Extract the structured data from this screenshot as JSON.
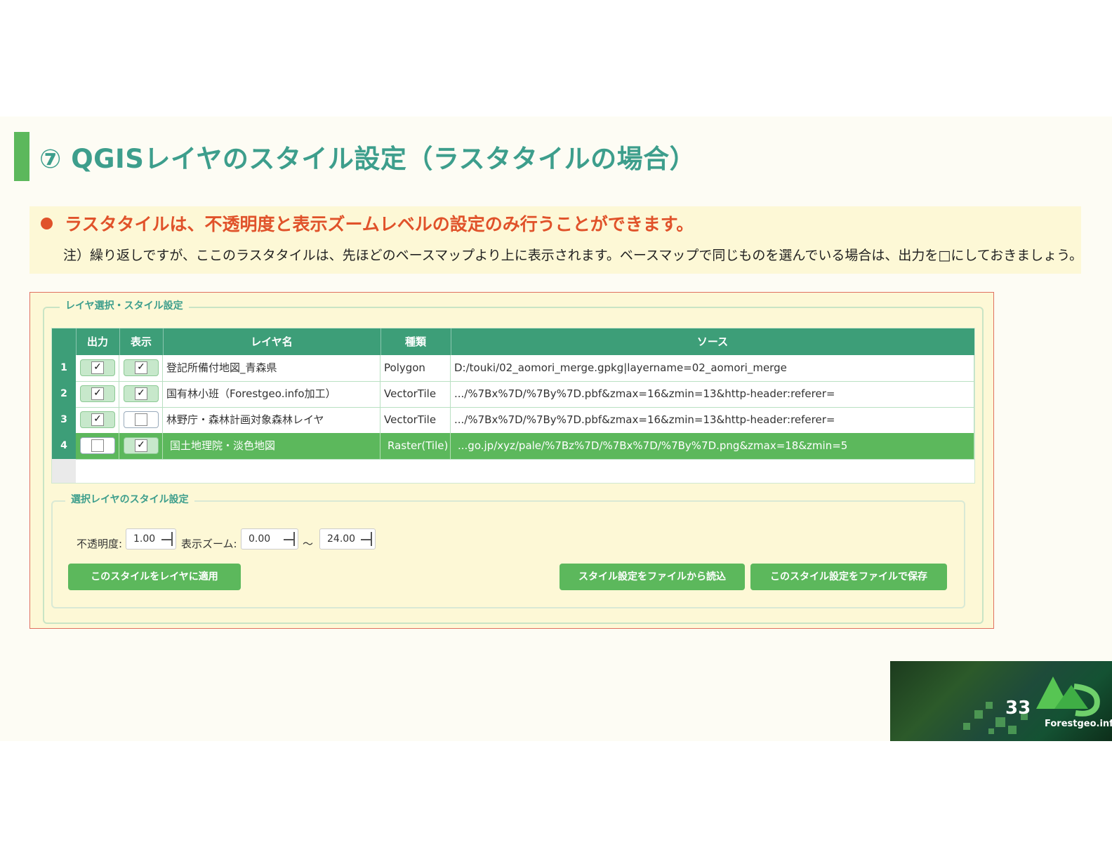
{
  "slide": {
    "title": "⑦ QGISレイヤのスタイル設定（ラスタタイルの場合）",
    "headline": "ラスタタイルは、不透明度と表示ズームレベルの設定のみ行うことができます。",
    "note": "注）繰り返しですが、ここのラスタタイルは、先ほどのベースマップより上に表示されます。ベースマップで同じものを選んでいる場合は、出力を□にしておきましょう。",
    "page_number": "33",
    "brand": "Forestgeo.info"
  },
  "panel": {
    "group_title": "レイヤ選択・スタイル設定",
    "columns": [
      "出力",
      "表示",
      "レイヤ名",
      "種類",
      "ソース"
    ],
    "rows": [
      {
        "num": "1",
        "output": true,
        "visible": true,
        "name": "登記所備付地図_青森県",
        "type": "Polygon",
        "source": "D:/touki/02_aomori_merge.gpkg|layername=02_aomori_merge",
        "selected": false
      },
      {
        "num": "2",
        "output": true,
        "visible": true,
        "name": "国有林小班（Forestgeo.info加工）",
        "type": "VectorTile",
        "source": ".../%7Bx%7D/%7By%7D.pbf&zmax=16&zmin=13&http-header:referer=",
        "selected": false
      },
      {
        "num": "3",
        "output": true,
        "visible": false,
        "name": "林野庁・森林計画対象森林レイヤ",
        "type": "VectorTile",
        "source": ".../%7Bx%7D/%7By%7D.pbf&zmax=16&zmin=13&http-header:referer=",
        "selected": false
      },
      {
        "num": "4",
        "output": false,
        "visible": true,
        "name": "国土地理院・淡色地図",
        "type": "Raster(Tile)",
        "source": "...go.jp/xyz/pale/%7Bz%7D/%7Bx%7D/%7By%7D.png&zmax=18&zmin=5",
        "selected": true
      }
    ],
    "check_mark": "✓",
    "style": {
      "title": "選択レイヤのスタイル設定",
      "opacity_label": "不透明度:",
      "opacity_value": "1.00",
      "zoom_label": "表示ズーム:",
      "zoom_min": "0.00",
      "tilde": "～",
      "zoom_max": "24.00",
      "apply_button": "このスタイルをレイヤに適用",
      "load_button": "スタイル設定をファイルから読込",
      "save_button": "このスタイル設定をファイルで保存"
    }
  },
  "colors": {
    "accent_green": "#5cb85c",
    "header_green": "#3d9e78",
    "title_teal": "#3d9e8c",
    "headline_orange": "#e0522a"
  }
}
